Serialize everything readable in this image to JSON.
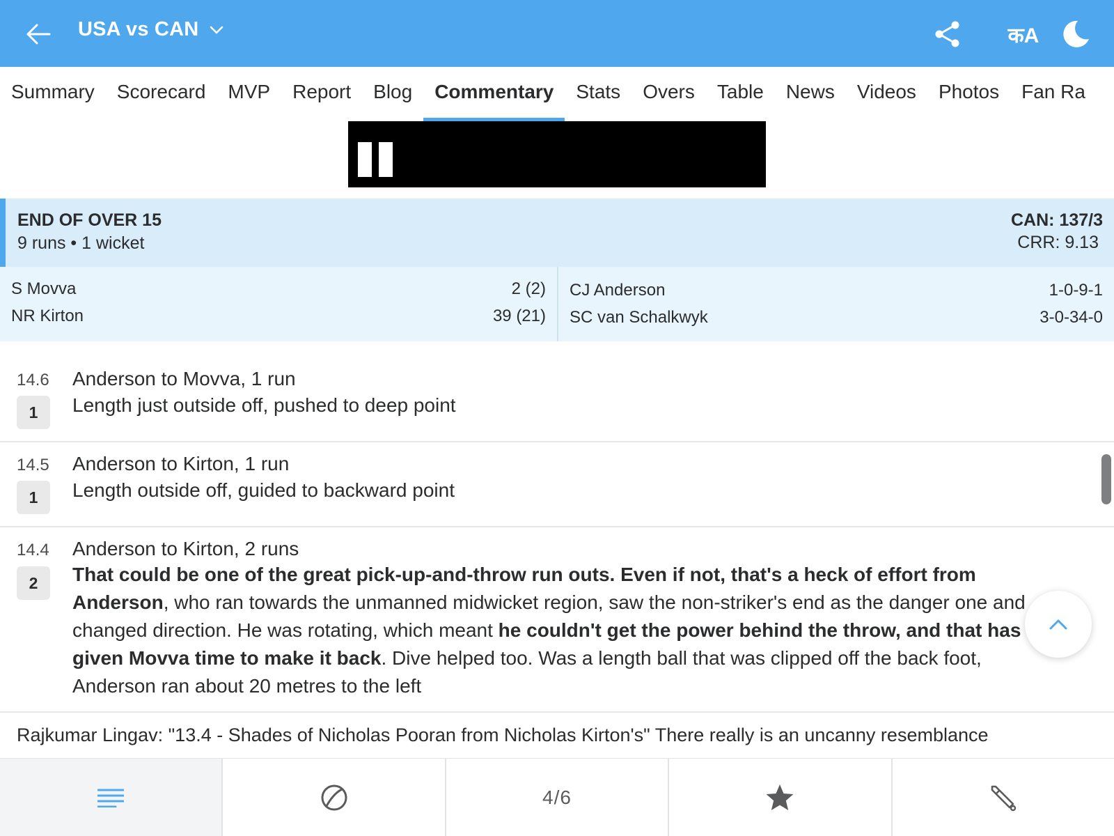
{
  "header": {
    "title": "USA vs CAN",
    "language_label": "कA"
  },
  "tabs": [
    {
      "label": "Summary",
      "active": false
    },
    {
      "label": "Scorecard",
      "active": false
    },
    {
      "label": "MVP",
      "active": false
    },
    {
      "label": "Report",
      "active": false
    },
    {
      "label": "Blog",
      "active": false
    },
    {
      "label": "Commentary",
      "active": true
    },
    {
      "label": "Stats",
      "active": false
    },
    {
      "label": "Overs",
      "active": false
    },
    {
      "label": "Table",
      "active": false
    },
    {
      "label": "News",
      "active": false
    },
    {
      "label": "Videos",
      "active": false
    },
    {
      "label": "Photos",
      "active": false
    },
    {
      "label": "Fan Ra",
      "active": false
    }
  ],
  "over_summary": {
    "title": "END OF OVER 15",
    "subtitle": "9 runs • 1 wicket",
    "score": "CAN: 137/3",
    "crr": "CRR: 9.13"
  },
  "batters": [
    {
      "name": "S Movva",
      "figures": "2 (2)"
    },
    {
      "name": "NR Kirton",
      "figures": "39 (21)"
    }
  ],
  "bowlers": [
    {
      "name": "CJ Anderson",
      "figures": "1-0-9-1"
    },
    {
      "name": "SC van Schalkwyk",
      "figures": "3-0-34-0"
    }
  ],
  "commentary": [
    {
      "over": "14.6",
      "runs": "1",
      "headline": "Anderson to Movva, 1 run",
      "text": "Length just outside off, pushed to deep point"
    },
    {
      "over": "14.5",
      "runs": "1",
      "headline": "Anderson to Kirton, 1 run",
      "text": "Length outside off, guided to backward point"
    },
    {
      "over": "14.4",
      "runs": "2",
      "headline": "Anderson to Kirton, 2 runs",
      "text_parts": [
        {
          "text": "That could be one of the great pick-up-and-throw run outs. Even if not, that's a heck of effort from Anderson",
          "bold": true
        },
        {
          "text": ", who ran towards the unmanned midwicket region, saw the non-striker's end as the danger one and changed direction. He was rotating, which meant ",
          "bold": false
        },
        {
          "text": "he couldn't get the power behind the throw, and that has given Movva time to make it back",
          "bold": true
        },
        {
          "text": ". Dive helped too. Was a length ball that was clipped off the back foot, Anderson ran about 20 metres to the left",
          "bold": false
        }
      ]
    }
  ],
  "note": "Rajkumar Lingav: \"13.4 - Shades of Nicholas Pooran from Nicholas Kirton's\" There really is an uncanny resemblance",
  "bottom_nav": {
    "page_indicator": "4/6"
  },
  "icons": {
    "back": "arrow-left-icon",
    "dropdown": "chevron-down-icon",
    "share": "share-icon",
    "language": "language-icon",
    "theme": "moon-icon",
    "scroll_top": "chevron-up-icon",
    "menu": "list-icon",
    "ball": "cricket-ball-icon",
    "star": "star-icon",
    "bat": "cricket-bat-icon"
  },
  "colors": {
    "header_bg": "#4fa8ed",
    "accent": "#4fa8ed",
    "summary_bg": "#d8ecfa",
    "players_bg": "#e9f5fd"
  }
}
